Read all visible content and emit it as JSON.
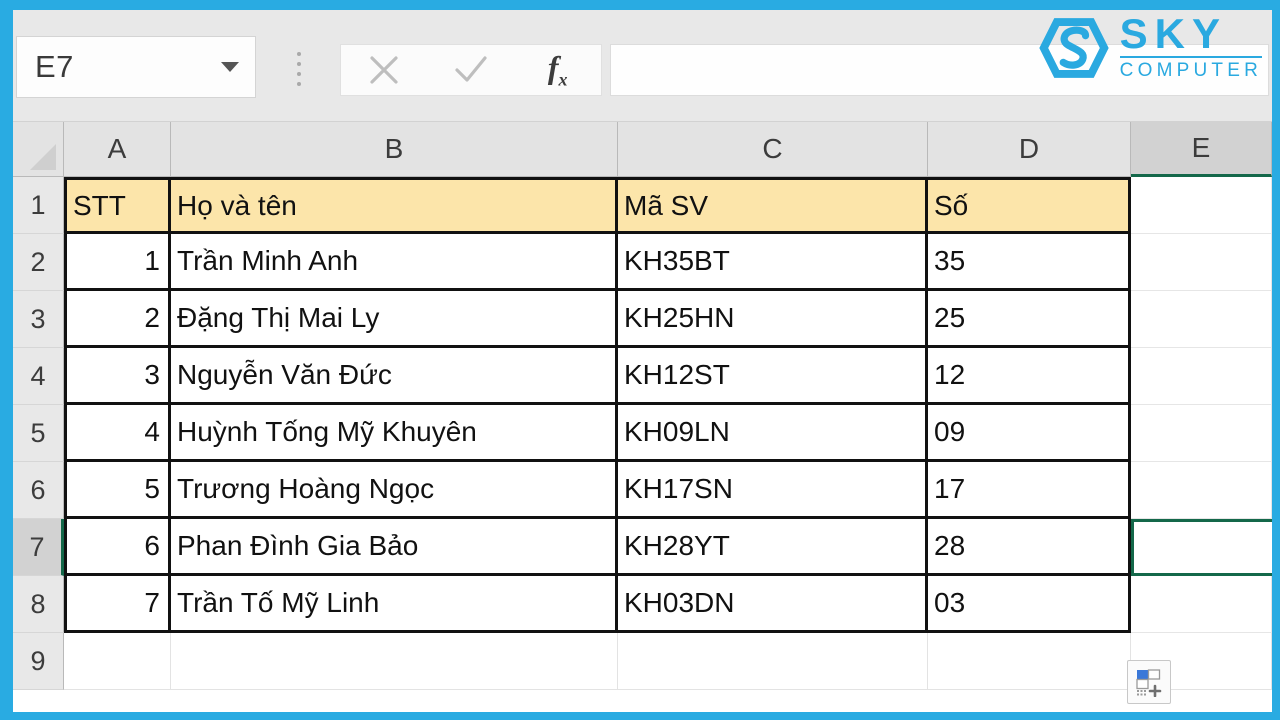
{
  "app": {
    "name_box_value": "E7",
    "formula_value": "",
    "formula_placeholder": "",
    "icons": {
      "dropdown": "chevron-down-icon",
      "cancel": "cancel-x-icon",
      "enter": "confirm-check-icon",
      "function": "fx-icon",
      "grip": "drag-grip-icon",
      "smart_tag": "quick-analysis-icon",
      "select_all": "select-all-corner-icon"
    },
    "fx_label": "f",
    "fx_sub": "x"
  },
  "branding": {
    "logo_primary": "SKY",
    "logo_secondary": "COMPUTER",
    "logo_color": "#2aa9e0"
  },
  "colors": {
    "frame": "#29abe2",
    "header_fill": "#fce5aa",
    "selection": "#14684a",
    "col_header": "#e3e3e3",
    "row_header": "#e8e8e8"
  },
  "grid": {
    "column_headers": [
      "A",
      "B",
      "C",
      "D",
      "E"
    ],
    "selected_column": "E",
    "row_headers": [
      "1",
      "2",
      "3",
      "4",
      "5",
      "6",
      "7",
      "8",
      "9"
    ],
    "selected_row": "7",
    "active_cell": "E7",
    "table_headers": {
      "A": "STT",
      "B": "Họ và tên",
      "C": "Mã SV",
      "D": "Số"
    },
    "rows": [
      {
        "row": "2",
        "stt": "1",
        "name": "Trần Minh Anh",
        "masv": "KH35BT",
        "so": "35"
      },
      {
        "row": "3",
        "stt": "2",
        "name": "Đặng Thị Mai Ly",
        "masv": "KH25HN",
        "so": "25"
      },
      {
        "row": "4",
        "stt": "3",
        "name": "Nguyễn Văn Đức",
        "masv": "KH12ST",
        "so": "12"
      },
      {
        "row": "5",
        "stt": "4",
        "name": "Huỳnh Tống Mỹ Khuyên",
        "masv": "KH09LN",
        "so": "09"
      },
      {
        "row": "6",
        "stt": "5",
        "name": "Trương Hoàng Ngọc",
        "masv": "KH17SN",
        "so": "17"
      },
      {
        "row": "7",
        "stt": "6",
        "name": "Phan Đình Gia Bảo",
        "masv": "KH28YT",
        "so": "28"
      },
      {
        "row": "8",
        "stt": "7",
        "name": "Trần Tố Mỹ Linh",
        "masv": "KH03DN",
        "so": "03"
      }
    ]
  }
}
